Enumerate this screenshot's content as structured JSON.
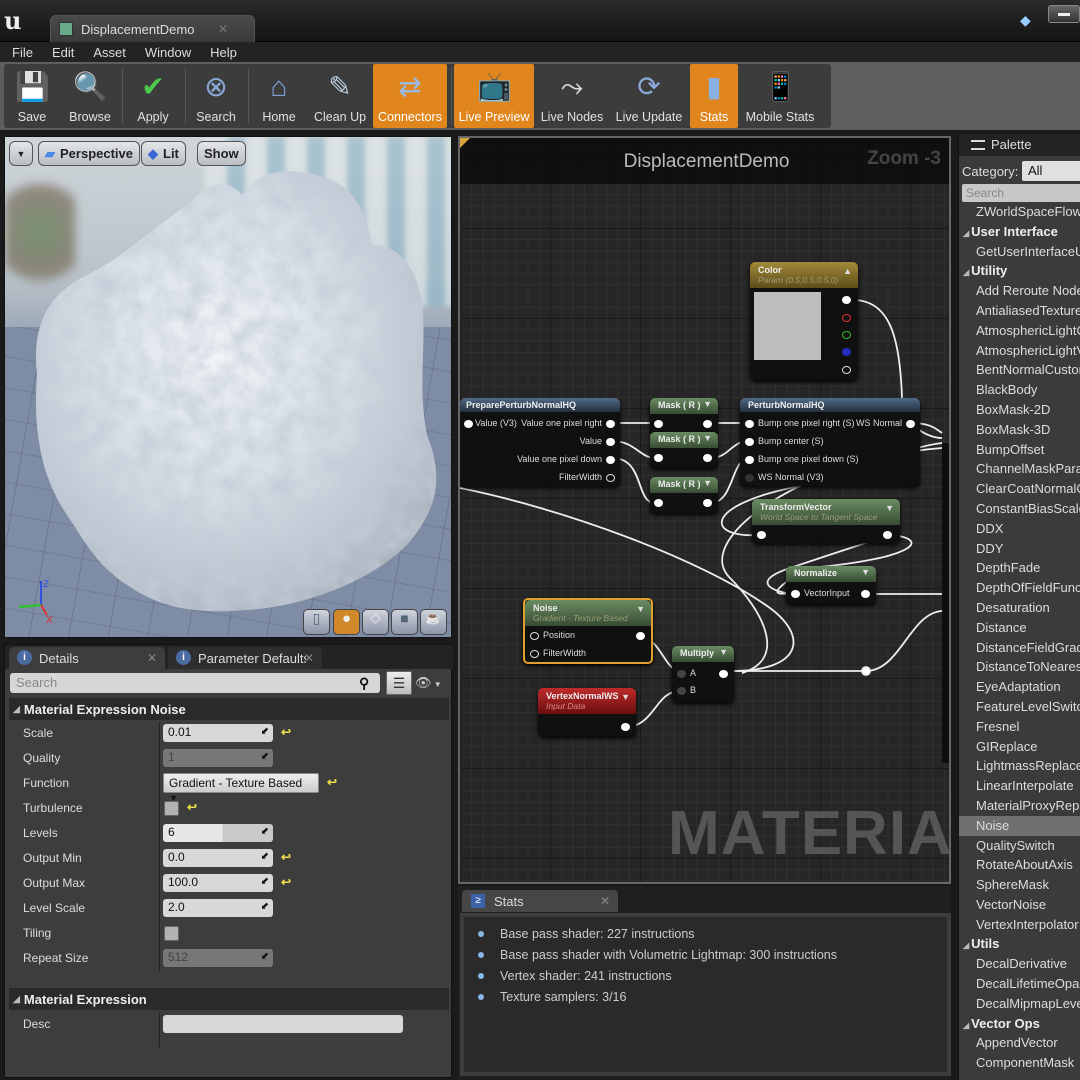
{
  "window": {
    "tab_title": "DisplacementDemo"
  },
  "menu": [
    "File",
    "Edit",
    "Asset",
    "Window",
    "Help"
  ],
  "toolbar": [
    {
      "label": "Save",
      "icon": "save-icon",
      "active": false
    },
    {
      "label": "Browse",
      "icon": "browse-icon",
      "active": false
    },
    {
      "label": "Apply",
      "icon": "apply-icon",
      "active": false
    },
    {
      "label": "Search",
      "icon": "search-icon",
      "active": false
    },
    {
      "label": "Home",
      "icon": "home-icon",
      "active": false
    },
    {
      "label": "Clean Up",
      "icon": "clean-up-icon",
      "active": false
    },
    {
      "label": "Connectors",
      "icon": "connectors-icon",
      "active": true
    },
    {
      "label": "Live Preview",
      "icon": "live-preview-icon",
      "active": true
    },
    {
      "label": "Live Nodes",
      "icon": "live-nodes-icon",
      "active": false
    },
    {
      "label": "Live Update",
      "icon": "live-update-icon",
      "active": false
    },
    {
      "label": "Stats",
      "icon": "stats-icon",
      "active": true
    },
    {
      "label": "Mobile Stats",
      "icon": "mobile-stats-icon",
      "active": false
    }
  ],
  "viewport": {
    "perspective_label": "Perspective",
    "lit_label": "Lit",
    "show_label": "Show",
    "axes": {
      "z": "Z",
      "x": "X"
    },
    "preview_shapes": [
      "cylinder",
      "sphere",
      "plane",
      "cube",
      "teapot"
    ],
    "preview_active": "sphere"
  },
  "details": {
    "tabs": [
      {
        "label": "Details"
      },
      {
        "label": "Parameter Defaults"
      }
    ],
    "search_placeholder": "Search",
    "section1": "Material Expression Noise",
    "props": [
      {
        "label": "Scale",
        "value": "0.01",
        "type": "number",
        "reset": true
      },
      {
        "label": "Quality",
        "value": "1",
        "type": "number",
        "disabled": true
      },
      {
        "label": "Function",
        "value": "Gradient - Texture Based",
        "type": "dropdown",
        "reset": true
      },
      {
        "label": "Turbulence",
        "value": false,
        "type": "checkbox",
        "reset": true
      },
      {
        "label": "Levels",
        "value": "6",
        "type": "slider"
      },
      {
        "label": "Output Min",
        "value": "0.0",
        "type": "number",
        "reset": true
      },
      {
        "label": "Output Max",
        "value": "100.0",
        "type": "number",
        "reset": true
      },
      {
        "label": "Level Scale",
        "value": "2.0",
        "type": "number"
      },
      {
        "label": "Tiling",
        "value": false,
        "type": "checkbox"
      },
      {
        "label": "Repeat Size",
        "value": "512",
        "type": "number",
        "disabled": true
      }
    ],
    "section2": "Material Expression",
    "desc_label": "Desc",
    "desc_value": ""
  },
  "graph": {
    "title": "DisplacementDemo",
    "zoom": "Zoom -3",
    "watermark": "MATERIAL",
    "nodes": {
      "color": {
        "title": "Color",
        "subtitle": "Param (0.5,0.5,0.5,0)"
      },
      "prepare": {
        "title": "PreparePerturbNormalHQ",
        "in": "Value (V3)",
        "outs": [
          "Value one pixel right",
          "Value",
          "Value one pixel down",
          "FilterWidth"
        ]
      },
      "mask": {
        "title": "Mask ( R )"
      },
      "perturb": {
        "title": "PerturbNormalHQ",
        "ins": [
          "Bump one pixel right (S)",
          "Bump center (S)",
          "Bump one pixel down (S)",
          "WS Normal (V3)"
        ],
        "out": "WS Normal"
      },
      "transform": {
        "title": "TransformVector",
        "subtitle": "World Space to Tangent Space"
      },
      "normalize": {
        "title": "Normalize",
        "in": "VectorInput"
      },
      "noise": {
        "title": "Noise",
        "subtitle": "Gradient - Texture Based",
        "ins": [
          "Position",
          "FilterWidth"
        ]
      },
      "multiply": {
        "title": "Multiply",
        "ins": [
          "A",
          "B"
        ]
      },
      "vertexnormal": {
        "title": "VertexNormalWS",
        "subtitle": "Input Data"
      }
    }
  },
  "stats": {
    "tab": "Stats",
    "lines": [
      "Base pass shader: 227 instructions",
      "Base pass shader with Volumetric Lightmap: 300 instructions",
      "Vertex shader: 241 instructions",
      "Texture samplers: 3/16"
    ]
  },
  "palette": {
    "tab": "Palette",
    "category_label": "Category:",
    "category_value": "All",
    "search_placeholder": "Search",
    "items": [
      {
        "label": "ZWorldSpaceFlow"
      },
      {
        "label": "User Interface",
        "header": true
      },
      {
        "label": "GetUserInterfaceUV"
      },
      {
        "label": "Utility",
        "header": true
      },
      {
        "label": "Add Reroute Node"
      },
      {
        "label": "AntialiasedTextureMask"
      },
      {
        "label": "AtmosphericLightColor"
      },
      {
        "label": "AtmosphericLightVector"
      },
      {
        "label": "BentNormalCustomOutput"
      },
      {
        "label": "BlackBody"
      },
      {
        "label": "BoxMask-2D"
      },
      {
        "label": "BoxMask-3D"
      },
      {
        "label": "BumpOffset"
      },
      {
        "label": "ChannelMaskParameter"
      },
      {
        "label": "ClearCoatNormalCustomOutput"
      },
      {
        "label": "ConstantBiasScale"
      },
      {
        "label": "DDX"
      },
      {
        "label": "DDY"
      },
      {
        "label": "DepthFade"
      },
      {
        "label": "DepthOfFieldFunction"
      },
      {
        "label": "Desaturation"
      },
      {
        "label": "Distance"
      },
      {
        "label": "DistanceFieldGradient"
      },
      {
        "label": "DistanceToNearestSurface"
      },
      {
        "label": "EyeAdaptation"
      },
      {
        "label": "FeatureLevelSwitch"
      },
      {
        "label": "Fresnel"
      },
      {
        "label": "GIReplace"
      },
      {
        "label": "LightmassReplace"
      },
      {
        "label": "LinearInterpolate"
      },
      {
        "label": "MaterialProxyReplace"
      },
      {
        "label": "Noise",
        "selected": true
      },
      {
        "label": "QualitySwitch"
      },
      {
        "label": "RotateAboutAxis"
      },
      {
        "label": "SphereMask"
      },
      {
        "label": "VectorNoise"
      },
      {
        "label": "VertexInterpolator"
      },
      {
        "label": "Utils",
        "header": true
      },
      {
        "label": "DecalDerivative"
      },
      {
        "label": "DecalLifetimeOpacity"
      },
      {
        "label": "DecalMipmapLevel"
      },
      {
        "label": "Vector Ops",
        "header": true
      },
      {
        "label": "AppendVector"
      },
      {
        "label": "ComponentMask"
      }
    ]
  }
}
